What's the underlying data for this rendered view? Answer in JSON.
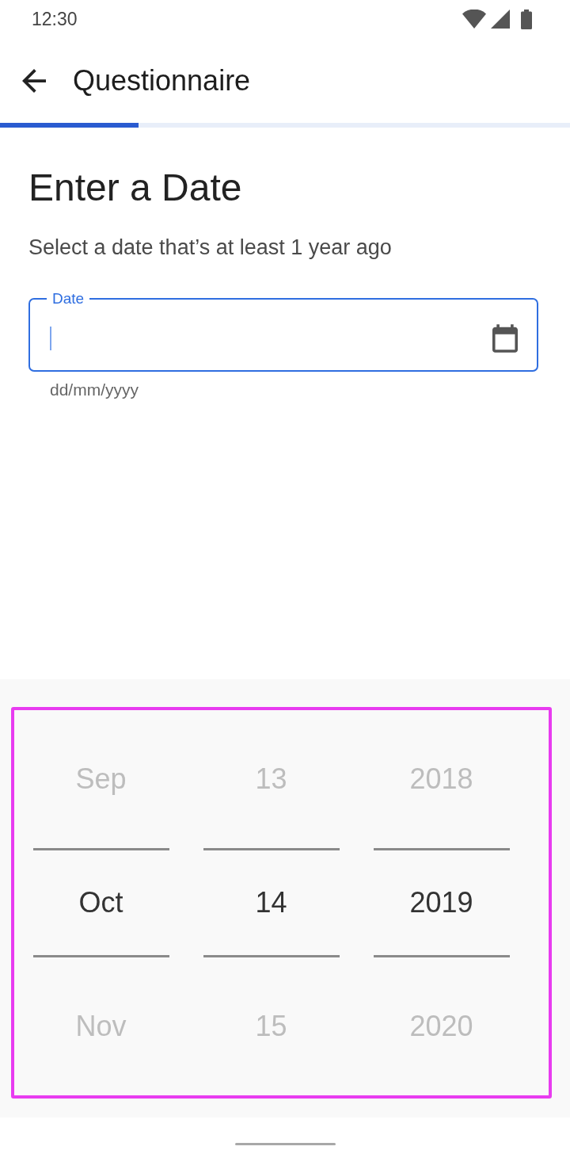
{
  "status_bar": {
    "time": "12:30"
  },
  "app_bar": {
    "title": "Questionnaire"
  },
  "progress": {
    "level": 0.243
  },
  "question": {
    "title": "Enter a Date",
    "subtitle": "Select a date that’s at least 1 year ago"
  },
  "date_field": {
    "label": "Date",
    "focused": true,
    "helper": "dd/mm/yyyy"
  },
  "picker": {
    "highlighted": true,
    "columns": [
      {
        "items": [
          {
            "label": "Sep",
            "selected": false
          },
          {
            "label": "Oct",
            "selected": true
          },
          {
            "label": "Nov",
            "selected": false
          }
        ]
      },
      {
        "items": [
          {
            "label": "13",
            "selected": false
          },
          {
            "label": "14",
            "selected": true
          },
          {
            "label": "15",
            "selected": false
          }
        ]
      },
      {
        "items": [
          {
            "label": "2018",
            "selected": false
          },
          {
            "label": "2019",
            "selected": true
          },
          {
            "label": "2020",
            "selected": false
          }
        ]
      }
    ]
  }
}
